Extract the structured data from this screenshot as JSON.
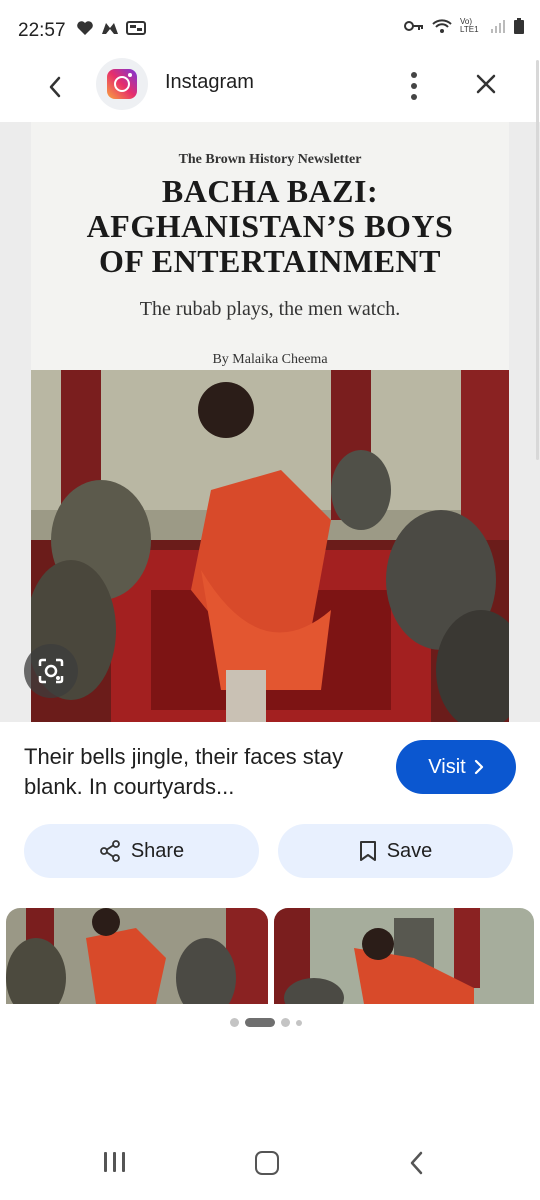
{
  "status_bar": {
    "time": "22:57",
    "network": "Vo) LTE1"
  },
  "top_bar": {
    "app_name": "Instagram",
    "app_icon": "instagram-logo",
    "accent_color": "#0b57d0"
  },
  "article": {
    "newsletter": "The Brown History Newsletter",
    "headline_lines": [
      "BACHA BAZI:",
      "AFGHANISTAN’S BOYS",
      "OF ENTERTAINMENT"
    ],
    "subhead": "The rubab plays, the men watch.",
    "byline": "By Malaika Cheema"
  },
  "result": {
    "caption": "Their bells jingle, their faces stay blank. In courtyards...",
    "visit_label": "Visit",
    "share_label": "Share",
    "save_label": "Save"
  },
  "carousel": {
    "page_count": 4,
    "active_index": 1
  }
}
